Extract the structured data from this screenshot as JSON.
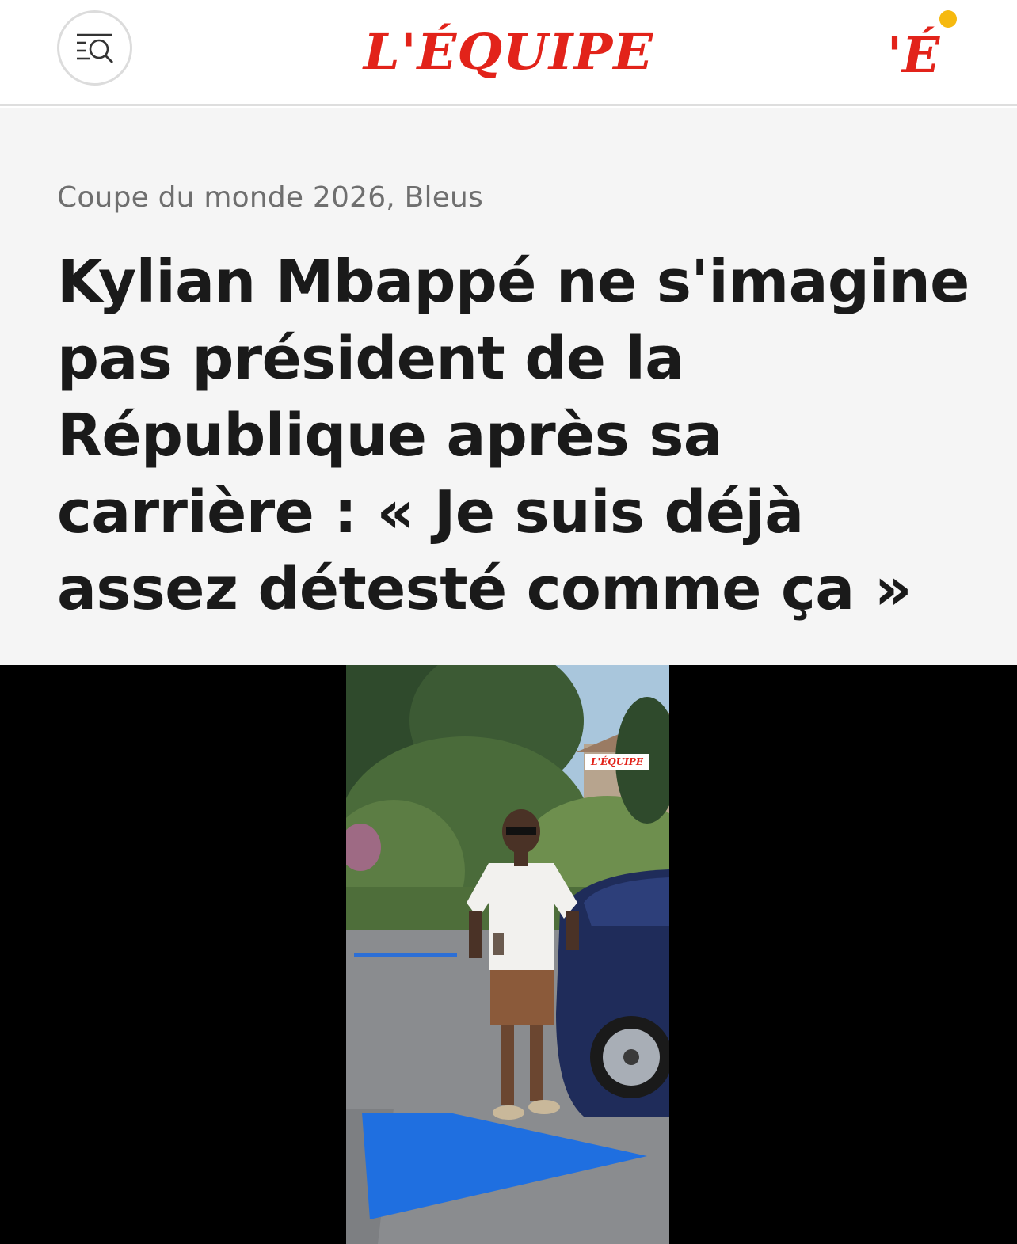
{
  "header": {
    "brand": "L'ÉQUIPE",
    "menu_icon": "menu-search-icon",
    "app_icon_letter": "'É",
    "notification_color": "#f6b90f",
    "accent_color": "#e2231a"
  },
  "article": {
    "breadcrumb": "Coupe du monde 2026, Bleus",
    "headline": "Kylian Mbappé ne s'imagine pas président de la République après sa carrière : « Je suis déjà assez détesté comme ça »"
  },
  "video": {
    "watermark": "L'ÉQUIPE"
  }
}
